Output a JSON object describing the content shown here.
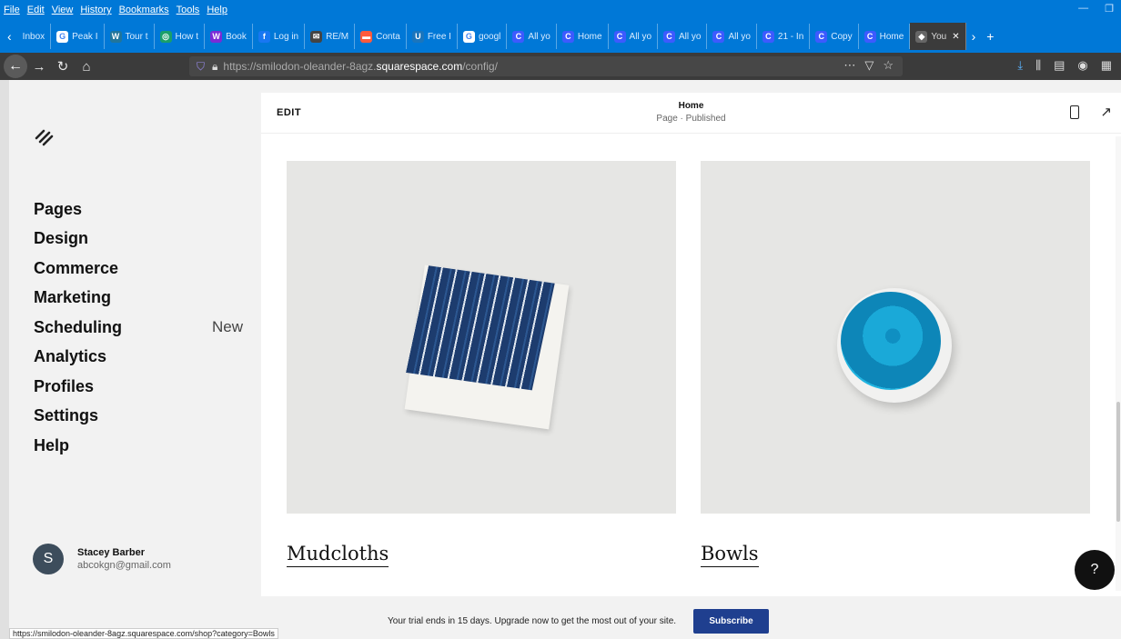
{
  "browser": {
    "menu": [
      "File",
      "Edit",
      "View",
      "History",
      "Bookmarks",
      "Tools",
      "Help"
    ],
    "tabs": [
      {
        "label": "Inbox",
        "icon": "back-arrow-icon",
        "color": "#0078d7"
      },
      {
        "label": "Peak I",
        "icon": "google-icon",
        "color": "#ffffff"
      },
      {
        "label": "Tour t",
        "icon": "wordpress-icon",
        "color": "#21759b"
      },
      {
        "label": "How t",
        "icon": "globe-icon",
        "color": "#1a9f6a"
      },
      {
        "label": "Book",
        "icon": "w-icon",
        "color": "#7a2bd6"
      },
      {
        "label": "Log in",
        "icon": "facebook-icon",
        "color": "#1877f2"
      },
      {
        "label": "RE/M",
        "icon": "mail-icon",
        "color": "#444"
      },
      {
        "label": "Conta",
        "icon": "contact-icon",
        "color": "#ff5a3c"
      },
      {
        "label": "Free I",
        "icon": "up-icon",
        "color": "#1b75bc"
      },
      {
        "label": "googl",
        "icon": "google-icon",
        "color": "#ffffff"
      },
      {
        "label": "All yo",
        "icon": "c-icon",
        "color": "#3d5afe"
      },
      {
        "label": "Home",
        "icon": "c-icon",
        "color": "#3d5afe"
      },
      {
        "label": "All yo",
        "icon": "c-icon",
        "color": "#3d5afe"
      },
      {
        "label": "All yo",
        "icon": "c-icon",
        "color": "#3d5afe"
      },
      {
        "label": "All yo",
        "icon": "c-icon",
        "color": "#3d5afe"
      },
      {
        "label": "21 - In",
        "icon": "c-icon",
        "color": "#3d5afe"
      },
      {
        "label": "Copy",
        "icon": "c-icon",
        "color": "#3d5afe"
      },
      {
        "label": "Home",
        "icon": "c-icon",
        "color": "#3d5afe"
      },
      {
        "label": "You",
        "icon": "squarespace-icon",
        "color": "#666",
        "active": true
      }
    ],
    "url_prefix": "https://smilodon-oleander-8agz.",
    "url_host": "squarespace.com",
    "url_path": "/config/",
    "status_url": "https://smilodon-oleander-8agz.squarespace.com/shop?category=Bowls"
  },
  "sidebar": {
    "items": [
      {
        "label": "Pages"
      },
      {
        "label": "Design"
      },
      {
        "label": "Commerce"
      },
      {
        "label": "Marketing"
      },
      {
        "label": "Scheduling",
        "badge": "New"
      },
      {
        "label": "Analytics"
      },
      {
        "label": "Profiles"
      },
      {
        "label": "Settings"
      },
      {
        "label": "Help"
      }
    ],
    "profile": {
      "initial": "S",
      "name": "Stacey Barber",
      "email": "abcokgn@gmail.com"
    }
  },
  "editor": {
    "edit_label": "EDIT",
    "page_title": "Home",
    "page_status": "Page · Published",
    "categories": [
      "Mudcloths",
      "Bowls"
    ]
  },
  "trial": {
    "text": "Your trial ends in 15 days. Upgrade now to get the most out of your site.",
    "button": "Subscribe"
  },
  "colors": {
    "browser_blue": "#0078d7",
    "subscribe": "#1f3f8f"
  }
}
